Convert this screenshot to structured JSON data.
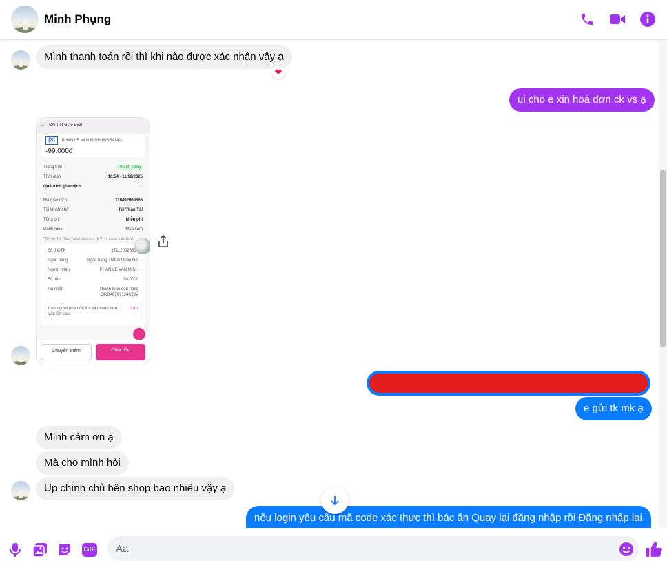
{
  "header": {
    "contact_name": "Minh Phụng",
    "actions": [
      "phone-icon",
      "video-call-icon",
      "info-icon"
    ]
  },
  "colors": {
    "accent_purple": "#a234f0",
    "outgoing_blue": "#0a7cff",
    "incoming_grey": "#f0f0f0",
    "redaction_red": "#e31d1d"
  },
  "messages": [
    {
      "from": "contact",
      "text": "Mình thanh toán rồi thì khi nào được xác nhận vậy ạ",
      "reaction": "❤"
    },
    {
      "from": "me",
      "text": "ui cho e xin hoá đơn ck vs ạ"
    },
    {
      "from": "contact",
      "type": "image"
    },
    {
      "from": "me",
      "type": "redacted"
    },
    {
      "from": "me",
      "text": "e gửi tk mk ạ"
    },
    {
      "from": "contact",
      "text": "Mình cảm ơn ạ"
    },
    {
      "from": "contact",
      "text": "Mà cho mình hỏi"
    },
    {
      "from": "contact",
      "text": "Up chính chủ bên shop bao nhiêu vậy ạ"
    },
    {
      "from": "me",
      "text": "nếu login yêu cầu mã code xác thực thì bác ấn Quay lại đăng nhập rồi Đăng nhập lại"
    }
  ],
  "receipt": {
    "title": "Chi Tiết Giao Dịch",
    "bank_logo": "[S]",
    "payee": "PHAN LE VAN MINH (MBBANK)",
    "amount": "-99.000đ",
    "rows": [
      {
        "label": "Trạng thái",
        "value": "Thành công"
      },
      {
        "label": "Thời gian",
        "value": "16:54 - 11/12/2025"
      },
      {
        "label": "Quá trình giao dịch",
        "value": "⌄"
      },
      {
        "label": "Mã giao dịch",
        "value": "110492069666"
      },
      {
        "label": "Tài khoản/thẻ",
        "value": "Túi Thần Tài"
      },
      {
        "label": "Tổng phí",
        "value": "Miễn phí"
      },
      {
        "label": "Danh mục",
        "value": "Mua sắm"
      }
    ],
    "note": "*Tiền từ Túi Thần Tài sẽ được rút về Ví và thanh toán từ Ví",
    "rows2": [
      {
        "label": "Số thẻ/TK",
        "value": "171120023333"
      },
      {
        "label": "Ngân hàng",
        "value": "Ngân hàng TMCP Quân Đội"
      },
      {
        "label": "Người nhận",
        "value": "PHAN LE VAN MINH"
      },
      {
        "label": "Số tiền",
        "value": "99.000đ"
      },
      {
        "label": "Tin nhắn",
        "value": "Thanh toan don hang ORD4679?124UJ3V"
      }
    ],
    "save_prompt": "Lưu người nhận để tìm lại nhanh hơn vào lần sau.",
    "save_button": "Lưu",
    "button_more": "Chuyển thêm",
    "button_split": "Chia tiền"
  },
  "composer": {
    "placeholder": "Aa",
    "tools": [
      "microphone-icon",
      "image-icon",
      "sticker-icon",
      "gif-icon"
    ],
    "gif_label": "GIF"
  }
}
